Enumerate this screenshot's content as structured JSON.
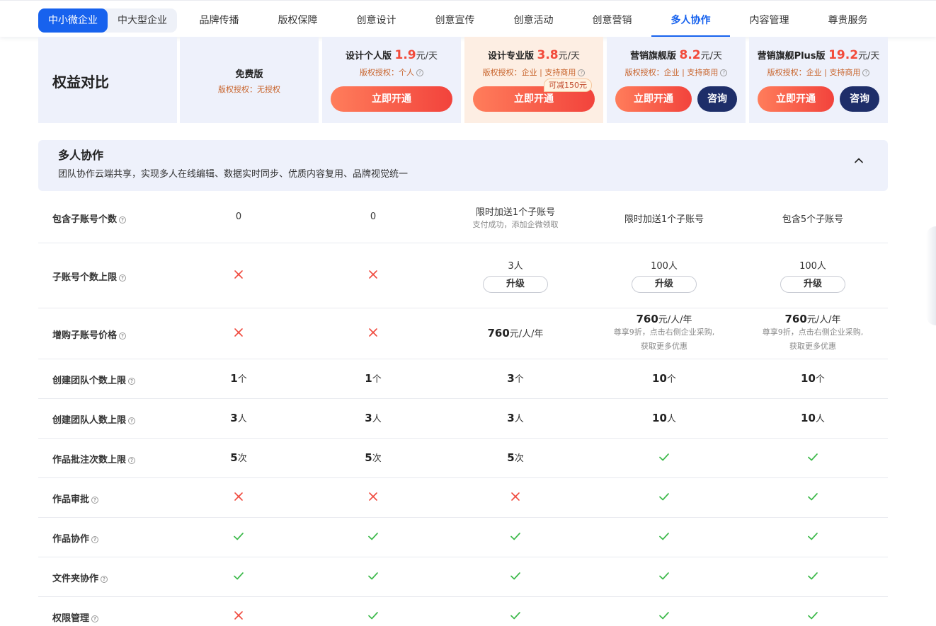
{
  "nav": {
    "segment": [
      "中小微企业",
      "中大型企业"
    ],
    "tabs": [
      "品牌传播",
      "版权保障",
      "创意设计",
      "创意宣传",
      "创意活动",
      "创意营销",
      "多人协作",
      "内容管理",
      "尊贵服务"
    ],
    "active_tab": "多人协作"
  },
  "plans": {
    "title": "权益对比",
    "free": {
      "name": "免费版",
      "license": "版权授权：无授权"
    },
    "items": [
      {
        "name": "设计个人版",
        "price": "1.9",
        "unit": "元/天",
        "license": "版权授权：个人",
        "button": "立即开通"
      },
      {
        "name": "设计专业版",
        "price": "3.8",
        "unit": "元/天",
        "license": "版权授权：企业 | 支持商用",
        "button": "立即开通",
        "promo": "可减150元"
      },
      {
        "name": "营销旗舰版",
        "price": "8.2",
        "unit": "元/天",
        "license": "版权授权：企业 | 支持商用",
        "button": "立即开通",
        "consult": "咨询"
      },
      {
        "name": "营销旗舰Plus版",
        "price": "19.2",
        "unit": "元/天",
        "license": "版权授权：企业 | 支持商用",
        "button": "立即开通",
        "consult": "咨询"
      }
    ]
  },
  "section": {
    "title": "多人协作",
    "desc": "团队协作云端共享，实现多人在线编辑、数据实时同步、优质内容复用、品牌视觉统一"
  },
  "rows": {
    "r1": {
      "label": "包含子账号个数",
      "c1": "0",
      "c2": "0",
      "c3": "限时加送1个子账号",
      "c3_sub": "支付成功，添加企微领取",
      "c4": "限时加送1个子账号",
      "c5": "包含5个子账号"
    },
    "r2": {
      "label": "子账号个数上限",
      "c3": "3人",
      "c4": "100人",
      "c5": "100人",
      "upgrade": "升级"
    },
    "r3": {
      "label": "增购子账号价格",
      "c3_num": "760",
      "c3_unit": "元/人/年",
      "c4_num": "760",
      "c4_unit": "元/人/年",
      "c4_sub1": "尊享9折，点击右侧企业采购,",
      "c4_sub2": "获取更多优惠",
      "c5_num": "760",
      "c5_unit": "元/人/年",
      "c5_sub1": "尊享9折，点击右侧企业采购,",
      "c5_sub2": "获取更多优惠"
    },
    "r4": {
      "label": "创建团队个数上限",
      "vals": [
        "1",
        "1",
        "3",
        "10",
        "10"
      ],
      "unit": "个"
    },
    "r5": {
      "label": "创建团队人数上限",
      "vals": [
        "3",
        "3",
        "3",
        "10",
        "10"
      ],
      "unit": "人"
    },
    "r6": {
      "label": "作品批注次数上限",
      "vals": [
        "5",
        "5",
        "5"
      ],
      "unit": "次"
    },
    "r7": {
      "label": "作品审批"
    },
    "r8": {
      "label": "作品协作"
    },
    "r9": {
      "label": "文件夹协作"
    },
    "r10": {
      "label": "权限管理"
    }
  },
  "colors": {
    "primary": "#1762ee",
    "price_red": "#f24a3a",
    "check_green": "#3cb94a",
    "cross_red": "#f04a3e",
    "consult_navy": "#1e2e69"
  }
}
